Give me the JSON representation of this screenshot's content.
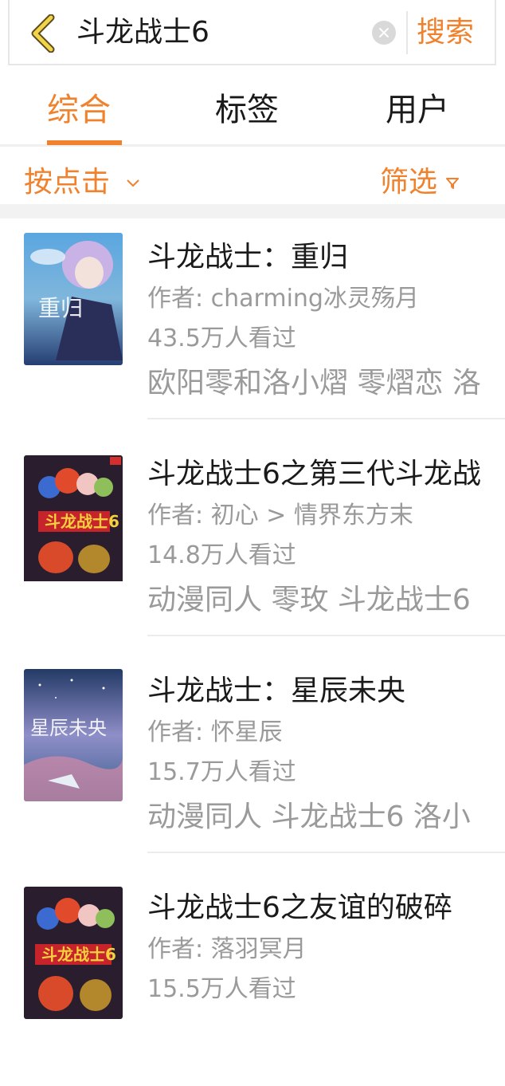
{
  "search": {
    "query": "斗龙战士6",
    "submit_label": "搜索"
  },
  "tabs": [
    {
      "label": "综合",
      "active": true
    },
    {
      "label": "标签",
      "active": false
    },
    {
      "label": "用户",
      "active": false
    }
  ],
  "sort": {
    "label": "按点击"
  },
  "filter": {
    "label": "筛选"
  },
  "colors": {
    "accent": "#f0822d",
    "text": "#1a1a1a",
    "muted": "#9a9a9a"
  },
  "results": [
    {
      "title": "斗龙战士：重归",
      "author": "作者: charming冰灵殇月",
      "views": "43.5万人看过",
      "tags": "欧阳零和洛小熠 零熠恋 洛"
    },
    {
      "title": "斗龙战士6之第三代斗龙战",
      "author": "作者: 初心 > 情界东方末",
      "views": "14.8万人看过",
      "tags": "动漫同人 零玫 斗龙战士6"
    },
    {
      "title": "斗龙战士：星辰未央",
      "author": "作者: 怀星辰",
      "views": "15.7万人看过",
      "tags": "动漫同人 斗龙战士6 洛小"
    },
    {
      "title": "斗龙战士6之友谊的破碎",
      "author": "作者: 落羽冥月",
      "views": "15.5万人看过",
      "tags": ""
    }
  ]
}
